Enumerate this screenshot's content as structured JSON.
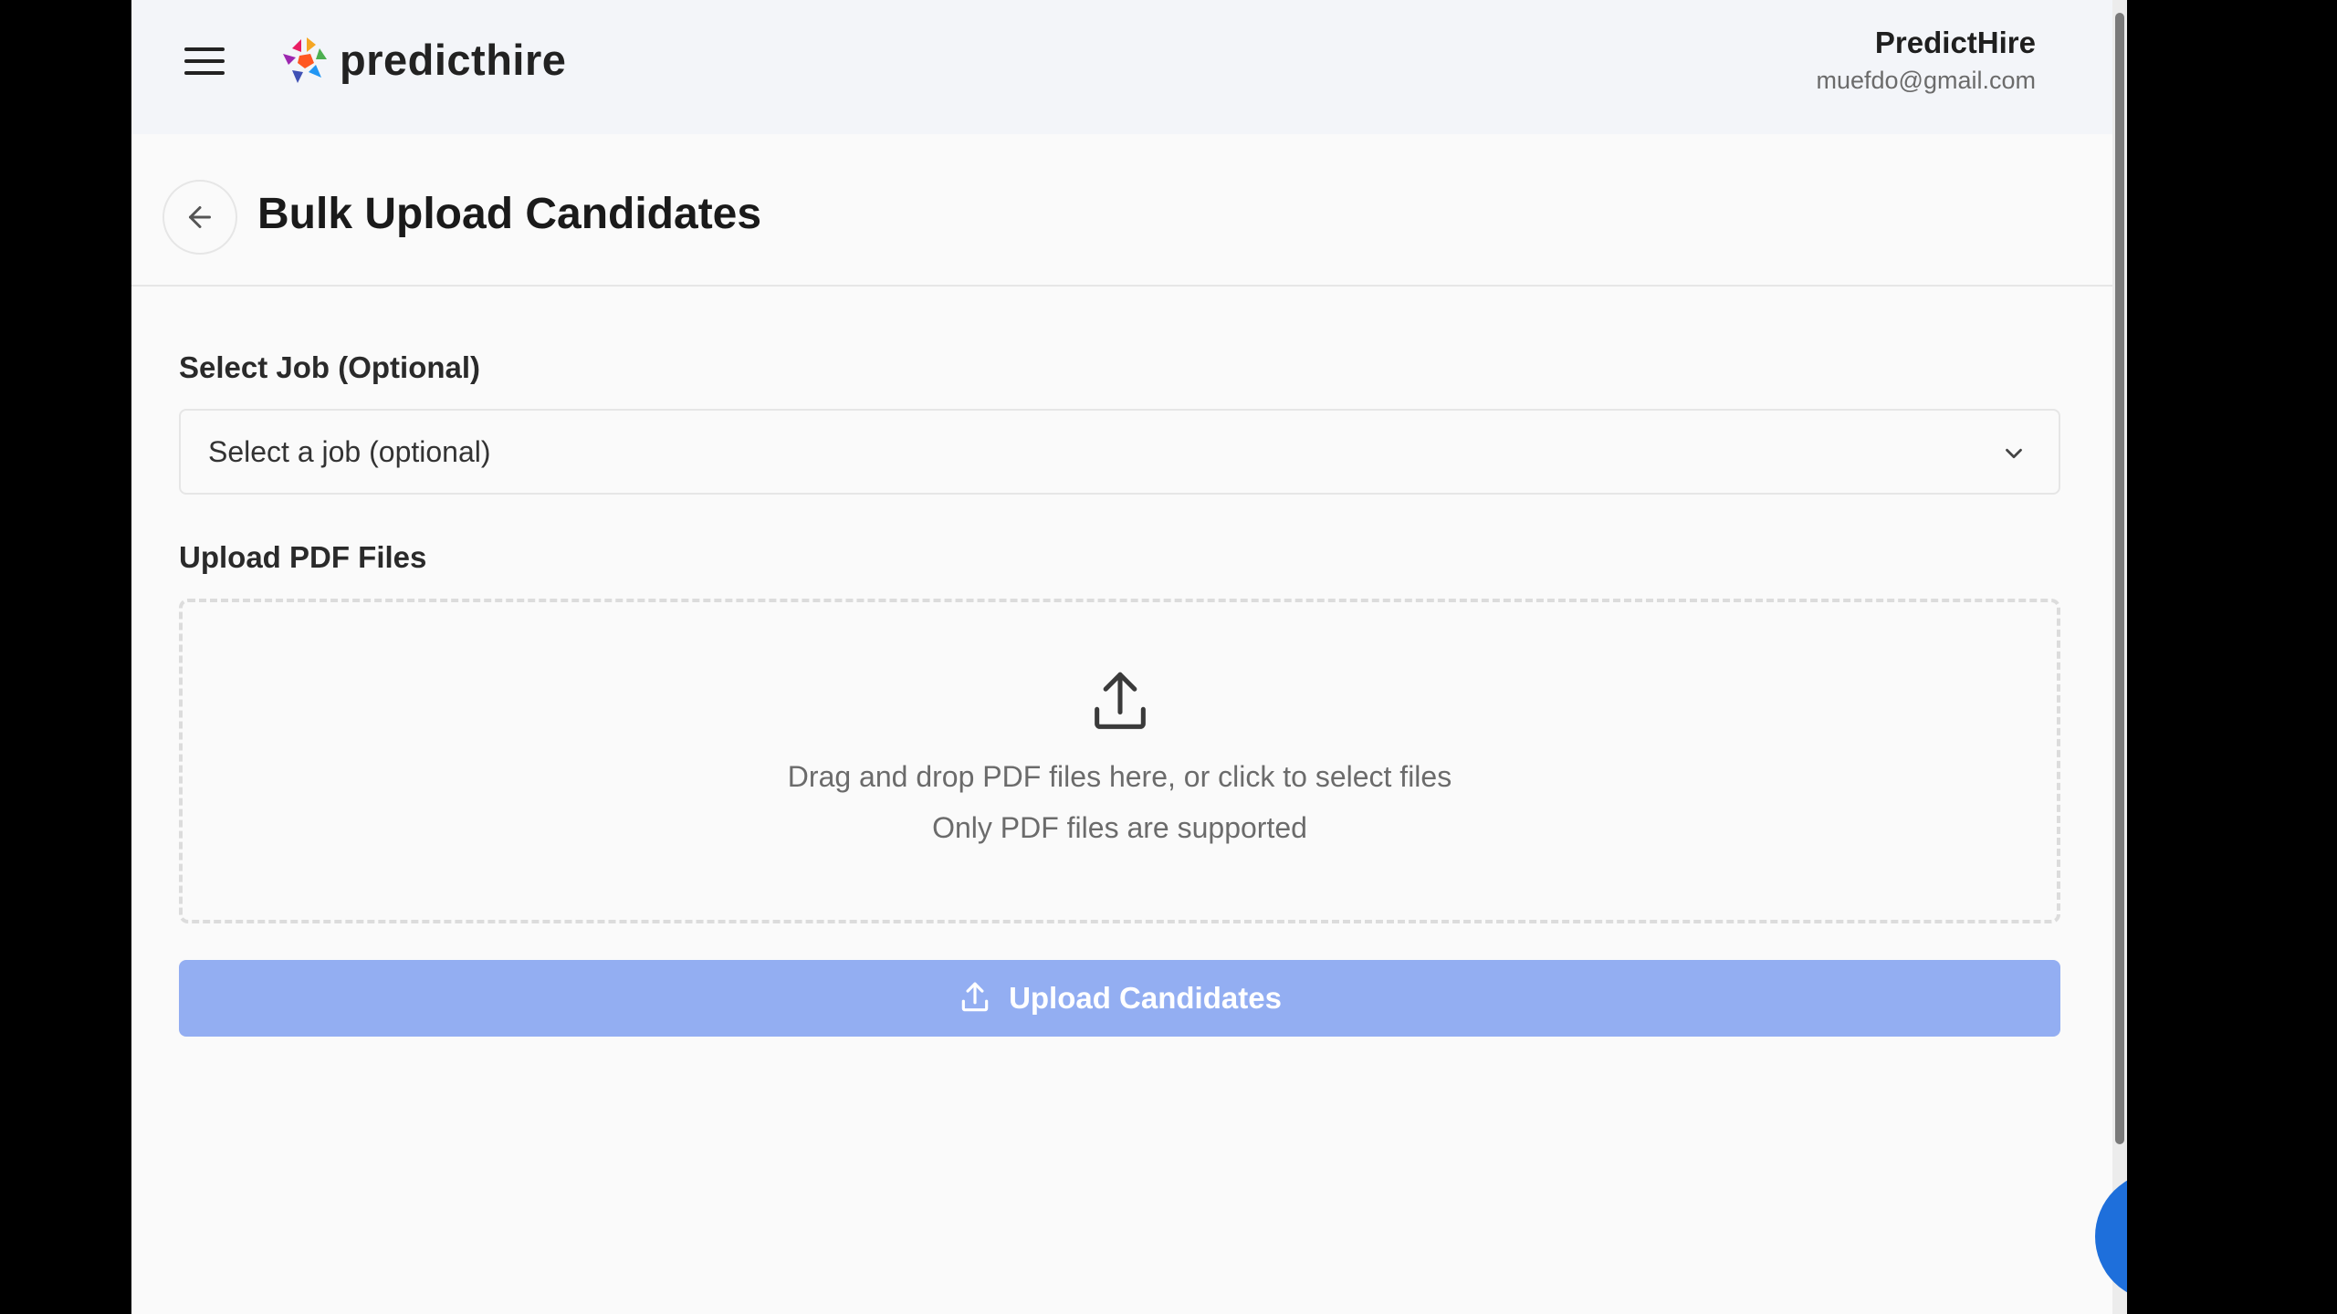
{
  "header": {
    "brand": "predicthire",
    "user_name": "PredictHire",
    "user_email": "muefdo@gmail.com"
  },
  "page": {
    "title": "Bulk Upload Candidates"
  },
  "form": {
    "job_label": "Select Job (Optional)",
    "job_select_value": "Select a job (optional)",
    "upload_label": "Upload PDF Files",
    "dropzone_text": "Drag and drop PDF files here, or click to select files",
    "dropzone_hint": "Only PDF files are supported",
    "submit_label": "Upload Candidates"
  },
  "colors": {
    "primary_disabled": "#93aef2",
    "chat": "#1e6fdb"
  },
  "icons": {
    "menu": "hamburger-menu-icon",
    "back": "arrow-left-icon",
    "chevron": "chevron-down-icon",
    "upload": "upload-icon",
    "chat": "chat-bubble-icon"
  }
}
